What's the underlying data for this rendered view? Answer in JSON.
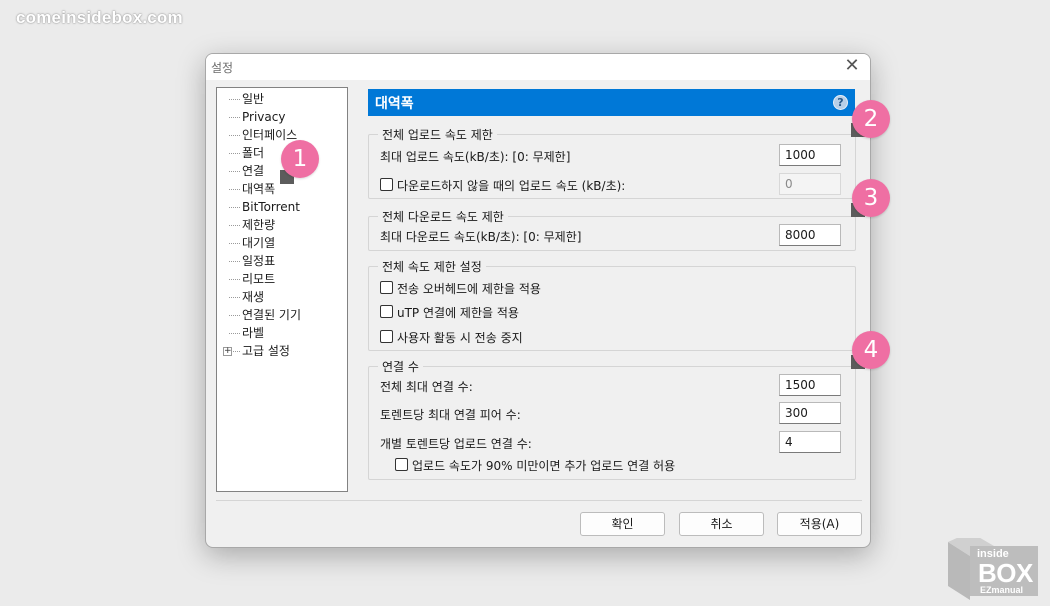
{
  "watermark": "comeinsidebox.com",
  "dialog": {
    "title": "설정",
    "close_glyph": "✕"
  },
  "sidebar": {
    "items": [
      {
        "label": "일반"
      },
      {
        "label": "Privacy"
      },
      {
        "label": "인터페이스"
      },
      {
        "label": "폴더"
      },
      {
        "label": "연결"
      },
      {
        "label": "대역폭"
      },
      {
        "label": "BitTorrent"
      },
      {
        "label": "제한량"
      },
      {
        "label": "대기열"
      },
      {
        "label": "일정표"
      },
      {
        "label": "리모트"
      },
      {
        "label": "재생"
      },
      {
        "label": "연결된 기기"
      },
      {
        "label": "라벨"
      },
      {
        "label": "고급 설정",
        "expander": "+"
      }
    ]
  },
  "panel": {
    "header": "대역폭",
    "help_glyph": "?",
    "upload_group": {
      "title": "전체 업로드 속도 제한",
      "max_label": "최대 업로드 속도(kB/초): [0: 무제한]",
      "max_value": "1000",
      "alt_label": "다운로드하지 않을 때의 업로드 속도 (kB/초):",
      "alt_value": "0",
      "alt_checked": false
    },
    "download_group": {
      "title": "전체 다운로드 속도 제한",
      "max_label": "최대 다운로드 속도(kB/초): [0: 무제한]",
      "max_value": "8000"
    },
    "global_group": {
      "title": "전체 속도 제한 설정",
      "options": [
        {
          "label": "전송 오버헤드에 제한을 적용",
          "checked": false
        },
        {
          "label": "uTP 연결에 제한을 적용",
          "checked": false
        },
        {
          "label": "사용자 활동 시 전송 중지",
          "checked": false
        }
      ]
    },
    "connections_group": {
      "title": "연결 수",
      "global_max_label": "전체 최대 연결 수:",
      "global_max_value": "1500",
      "per_torrent_label": "토렌트당 최대 연결 피어 수:",
      "per_torrent_value": "300",
      "upload_slots_label": "개별 토렌트당 업로드 연결 수:",
      "upload_slots_value": "4",
      "extra_label": "업로드 속도가 90% 미만이면 추가 업로드 연결 허용",
      "extra_checked": false
    }
  },
  "buttons": {
    "ok": "확인",
    "cancel": "취소",
    "apply": "적용(A)"
  },
  "badges": [
    "1",
    "2",
    "3",
    "4"
  ],
  "logo": {
    "line1": "inside",
    "line2": "BOX",
    "line3": "EZmanual"
  },
  "colors": {
    "header_blue": "#0078d7",
    "badge_pink": "#ef6fa3"
  }
}
